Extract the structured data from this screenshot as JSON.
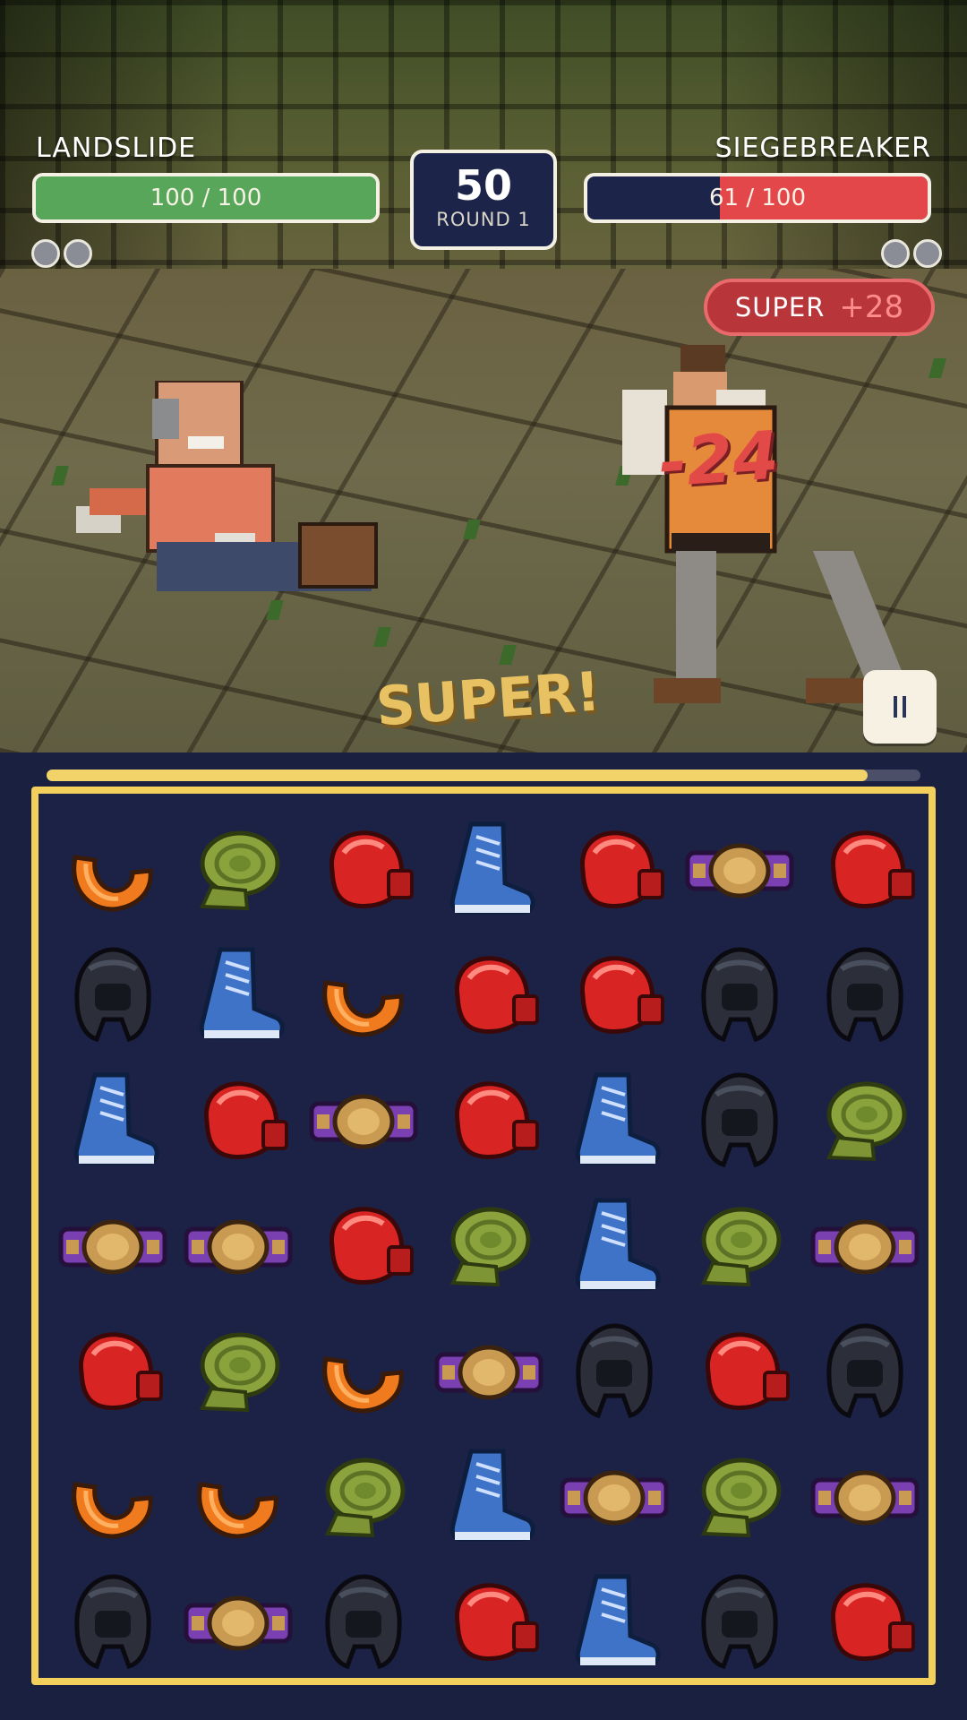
{
  "player": {
    "name": "LANDSLIDE",
    "hp_text": "100 / 100",
    "hp": 100,
    "hp_max": 100,
    "round_pips": 2
  },
  "opponent": {
    "name": "SIEGEBREAKER",
    "hp_text": "61 / 100",
    "hp": 61,
    "hp_max": 100,
    "round_pips": 2
  },
  "timer": {
    "value": "50",
    "round_label": "ROUND 1"
  },
  "super_badge": {
    "label": "SUPER",
    "bonus": "+28"
  },
  "damage_popup": "-24",
  "callout": "SUPER!",
  "pause_icon": "pause-icon",
  "move_progress": 0.94,
  "colors": {
    "player_hp": "#57a65a",
    "opponent_hp": "#e4474a",
    "board_border": "#f3cf5b",
    "panel": "#1c2449"
  },
  "board": {
    "rows": [
      [
        "mouthguard",
        "hand-wraps",
        "boxing-glove",
        "boxing-boot",
        "boxing-glove",
        "championship-belt",
        "boxing-glove"
      ],
      [
        "headgear",
        "boxing-boot",
        "mouthguard",
        "boxing-glove",
        "boxing-glove",
        "headgear",
        "headgear"
      ],
      [
        "boxing-boot",
        "boxing-glove",
        "championship-belt",
        "boxing-glove",
        "boxing-boot",
        "headgear",
        "hand-wraps"
      ],
      [
        "championship-belt",
        "championship-belt",
        "boxing-glove",
        "hand-wraps",
        "boxing-boot",
        "hand-wraps",
        "championship-belt"
      ],
      [
        "boxing-glove",
        "hand-wraps",
        "mouthguard",
        "championship-belt",
        "headgear",
        "boxing-glove",
        "headgear"
      ],
      [
        "mouthguard",
        "mouthguard",
        "hand-wraps",
        "boxing-boot",
        "championship-belt",
        "hand-wraps",
        "championship-belt"
      ],
      [
        "headgear",
        "championship-belt",
        "headgear",
        "boxing-glove",
        "boxing-boot",
        "headgear",
        "boxing-glove"
      ]
    ]
  }
}
